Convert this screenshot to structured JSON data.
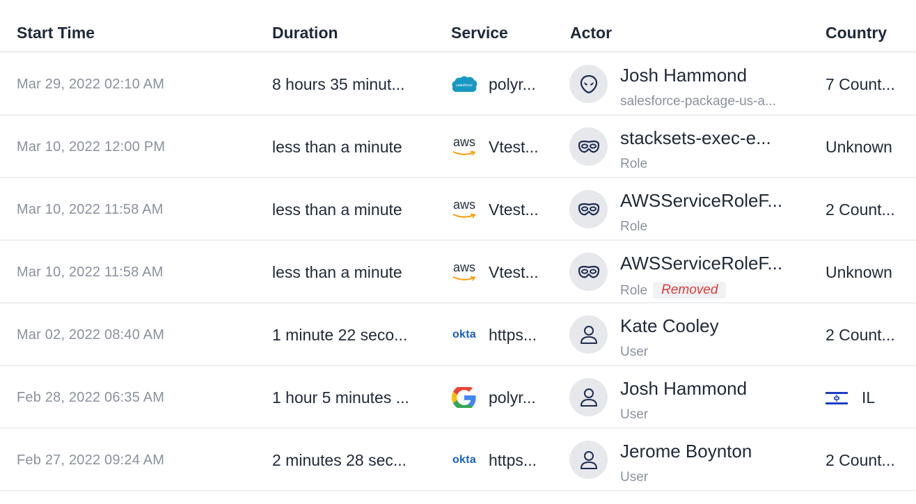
{
  "columns": {
    "start_time": "Start Time",
    "duration": "Duration",
    "service": "Service",
    "actor": "Actor",
    "country": "Country"
  },
  "rows": [
    {
      "start_time": "Mar 29, 2022 02:10 AM",
      "duration": "8 hours 35 minut...",
      "service_icon": "salesforce-logo",
      "service": "polyr...",
      "actor_icon": "alien-icon",
      "actor_name": "Josh Hammond",
      "actor_sub": "salesforce-package-us-a...",
      "badge": "",
      "country": "7 Count...",
      "flag": ""
    },
    {
      "start_time": "Mar 10, 2022 12:00 PM",
      "duration": "less than a minute",
      "service_icon": "aws-logo",
      "service": "Vtest...",
      "actor_icon": "mask-icon",
      "actor_name": "stacksets-exec-e...",
      "actor_sub": "Role",
      "badge": "",
      "country": "Unknown",
      "flag": ""
    },
    {
      "start_time": "Mar 10, 2022 11:58 AM",
      "duration": "less than a minute",
      "service_icon": "aws-logo",
      "service": "Vtest...",
      "actor_icon": "mask-icon",
      "actor_name": "AWSServiceRoleF...",
      "actor_sub": "Role",
      "badge": "",
      "country": "2 Count...",
      "flag": ""
    },
    {
      "start_time": "Mar 10, 2022 11:58 AM",
      "duration": "less than a minute",
      "service_icon": "aws-logo",
      "service": "Vtest...",
      "actor_icon": "mask-icon",
      "actor_name": "AWSServiceRoleF...",
      "actor_sub": "Role",
      "badge": "Removed",
      "country": "Unknown",
      "flag": ""
    },
    {
      "start_time": "Mar 02, 2022 08:40 AM",
      "duration": "1 minute 22 seco...",
      "service_icon": "okta-logo",
      "service": "https...",
      "actor_icon": "user-icon",
      "actor_name": "Kate Cooley",
      "actor_sub": "User",
      "badge": "",
      "country": "2 Count...",
      "flag": ""
    },
    {
      "start_time": "Feb 28, 2022 06:35 AM",
      "duration": "1 hour 5 minutes ...",
      "service_icon": "google-logo",
      "service": "polyr...",
      "actor_icon": "user-icon",
      "actor_name": "Josh Hammond",
      "actor_sub": "User",
      "badge": "",
      "country": "IL",
      "flag": "israel-flag"
    },
    {
      "start_time": "Feb 27, 2022 09:24 AM",
      "duration": "2 minutes 28 sec...",
      "service_icon": "okta-logo",
      "service": "https...",
      "actor_icon": "user-icon",
      "actor_name": "Jerome Boynton",
      "actor_sub": "User",
      "badge": "",
      "country": "2 Count...",
      "flag": ""
    }
  ],
  "logo_text": {
    "salesforce": "salesforce",
    "aws": "aws",
    "okta": "okta"
  },
  "colors": {
    "text_primary": "#1f2937",
    "text_muted": "#8a919c",
    "divider": "#eef0f3",
    "avatar_bg": "#e6e8ec",
    "icon_navy": "#1e2b4f",
    "removed_red": "#dc3b3b",
    "salesforce_blue": "#1798c1",
    "aws_orange": "#ff9900",
    "okta_blue": "#1661b8"
  }
}
